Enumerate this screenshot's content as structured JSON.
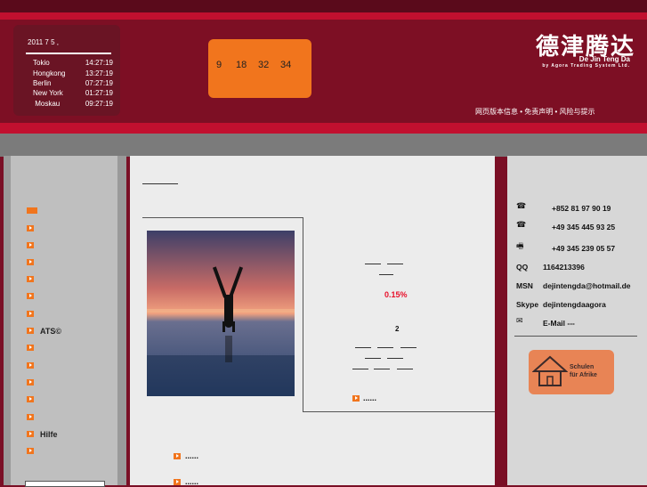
{
  "clocks": {
    "date": "2011  7  5 ,",
    "rows": [
      {
        "city": "Tokio",
        "time": "14:27:19"
      },
      {
        "city": "Hongkong",
        "time": "13:27:19"
      },
      {
        "city": "Berlin",
        "time": "07:27:19"
      },
      {
        "city": "New York",
        "time": "01:27:19"
      },
      {
        "city": " Moskau",
        "time": "09:27:19"
      }
    ]
  },
  "lottery": {
    "numbers": [
      "9",
      "18",
      "32",
      "34"
    ]
  },
  "logo": {
    "chinese": "德津腾达",
    "english": "De Jin Teng Da",
    "subtitle": "by Agora Trading System Ltd."
  },
  "header_links": "网页版本信息 • 免责声明 • 风险与提示",
  "nav": {
    "ats_label": "ATS©",
    "hilfe_label": "Hilfe"
  },
  "main": {
    "percentage": "0.15%",
    "number": "2",
    "more1": "......",
    "more2": "......",
    "more3": "......"
  },
  "contact": {
    "phone1": "+852 81 97 90 19",
    "phone2": "+49 345 445 93 25",
    "fax": "+49 345 239 05 57",
    "qq_label": "QQ",
    "qq_value": "1164213396",
    "msn_label": "MSN",
    "msn_value": "dejintengda@hotmail.de",
    "skype_label": "Skype",
    "skype_value": "dejintengdaagora",
    "email_label": "E-Mail ---"
  },
  "badge": {
    "line1": "Schulen",
    "line2": "für Afrike"
  },
  "colors": {
    "accent": "#f1751d",
    "brand": "#7d0f24",
    "stripe": "#c1102f",
    "highlight": "#e8102a"
  }
}
